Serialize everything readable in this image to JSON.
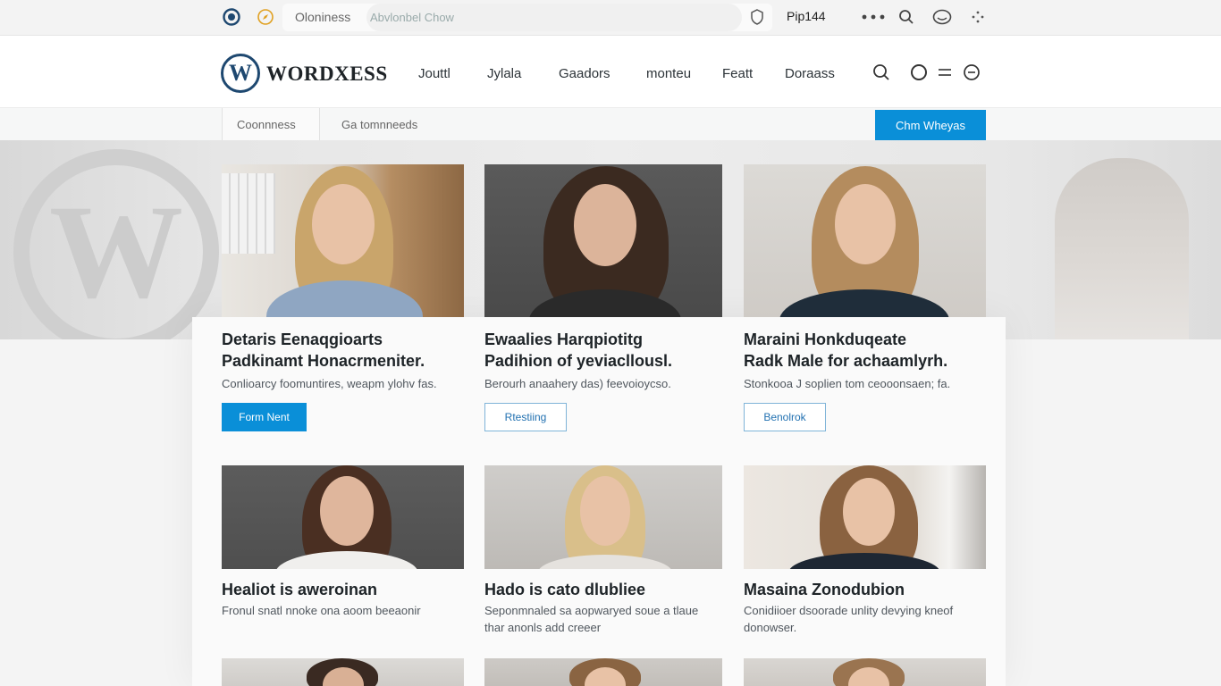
{
  "browser": {
    "site_tab": "Oloniness",
    "url": "Abvlonbel Chow",
    "page_label": "Pip144",
    "icons": [
      "wordpress-icon",
      "compass-icon",
      "shield-icon",
      "more-icon",
      "search-icon",
      "account-icon",
      "extensions-icon"
    ]
  },
  "header": {
    "brand": "WORDXESS",
    "logo_letter": "W",
    "nav": [
      "Jouttl",
      "Jylala",
      "Gaadors",
      "monteu",
      "Featt",
      "Doraass"
    ]
  },
  "subbar": {
    "link_a": "Coonnness",
    "link_b": "Ga tomnneeds",
    "cta": "Chm Wheyas"
  },
  "hero": {
    "watermark_letter": "W"
  },
  "cards_row1": [
    {
      "title_line1": "Detaris Eenaqgioarts",
      "title_line2": "Padkinamt Honacrmeniter.",
      "desc": "Conlioarcy foomuntires, weapm ylohv fas.",
      "button": "Form Nent",
      "button_style": "solid"
    },
    {
      "title_line1": "Ewaalies Harqpiotitg",
      "title_line2": "Padihion of yeviacllousl.",
      "desc": "Berourh anaahery das) feevoioycso.",
      "button": "Rtestiing",
      "button_style": "outline"
    },
    {
      "title_line1": "Maraini Honkduqeate",
      "title_line2": "Radk Male for achaamlyrh.",
      "desc": "Stonkooa J soplien tom ceooonsaen; fa.",
      "button": "Benolrok",
      "button_style": "outline"
    }
  ],
  "cards_row2": [
    {
      "title": "Healiot is aweroinan",
      "desc_line1": "Fronul snatl nnoke ona aoom beeaonir",
      "desc_line2": ""
    },
    {
      "title": "Hado is cato dlubliee",
      "desc_line1": "Seponmnaled sa aopwaryed soue a tlaue",
      "desc_line2": "thar anonls add creeer"
    },
    {
      "title": "Masaina Zonodubion",
      "desc_line1": "Conidiioer dsoorade unlity devying kneof",
      "desc_line2": "donowser."
    }
  ],
  "colors": {
    "accent": "#0a8fd8",
    "brand_dark": "#1e4870",
    "text": "#1d2327"
  }
}
